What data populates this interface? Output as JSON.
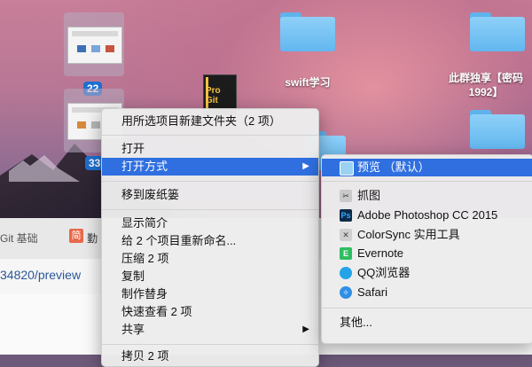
{
  "desktop": {
    "thumbnails": [
      {
        "badge": "22"
      },
      {
        "badge": "33"
      }
    ],
    "items": [
      {
        "label": "swift学习"
      },
      {
        "label_line1": "此群独享【密码",
        "label_line2": "1992】"
      }
    ],
    "book": {
      "title": "Pro Git"
    }
  },
  "browser": {
    "tab1": "Git 基础",
    "tab2_icon": "简",
    "tab2": "勤",
    "url": "34820/preview"
  },
  "context_menu": {
    "items": [
      {
        "label": "用所选项目新建文件夹（2 项）"
      },
      {
        "label": "打开"
      },
      {
        "label": "打开方式",
        "arrow": "▶"
      },
      {
        "label": "移到废纸篓"
      },
      {
        "label": "显示简介"
      },
      {
        "label": "给 2 个项目重新命名..."
      },
      {
        "label": "压缩 2 项"
      },
      {
        "label": "复制"
      },
      {
        "label": "制作替身"
      },
      {
        "label": "快速查看 2 项"
      },
      {
        "label": "共享",
        "arrow": "▶"
      },
      {
        "label": "拷贝 2 项"
      }
    ]
  },
  "open_with": {
    "items": [
      {
        "label": "预览 （默认）",
        "icon": "preview-icon"
      },
      {
        "label": "抓图",
        "icon": "grab-icon"
      },
      {
        "label": "Adobe Photoshop CC 2015",
        "icon": "photoshop-icon"
      },
      {
        "label": "ColorSync 实用工具",
        "icon": "colorsync-icon"
      },
      {
        "label": "Evernote",
        "icon": "evernote-icon"
      },
      {
        "label": "QQ浏览器",
        "icon": "qqbrowser-icon"
      },
      {
        "label": "Safari",
        "icon": "safari-icon"
      },
      {
        "label": "其他..."
      }
    ]
  },
  "colors": {
    "selection": "#2f6fe0",
    "badge": "#1f6fd1",
    "folder": "#62b7ef"
  }
}
